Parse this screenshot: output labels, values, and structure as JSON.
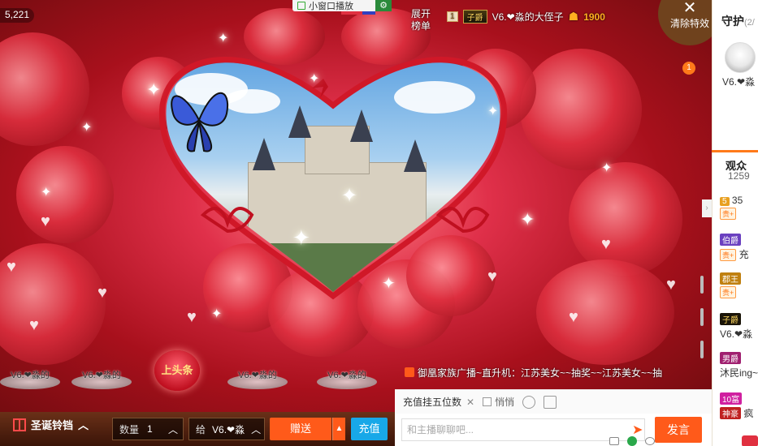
{
  "top_bar": {
    "viewer_count": "5,221",
    "mini_window_label": "小窗口播放",
    "expand_list_line1": "展开",
    "expand_list_line2": "榜单",
    "rank_number": "1",
    "rank_noble_badge": "子爵",
    "rank_user_name": "V6.❤淼的大侄子",
    "rank_coin_amount": "1900",
    "clear_effects_label": "清除特效"
  },
  "right_panel": {
    "guard_title": "守护",
    "guard_count": "(2/",
    "guard_user_name": "V6.❤淼",
    "audience_title": "观众",
    "audience_count": "1259",
    "audience_rows": [
      {
        "level": "5",
        "tag": "贵+",
        "extra": "35"
      },
      {
        "level": "伯爵",
        "tag": "贵+",
        "extra": "充"
      },
      {
        "level": "郡王",
        "tag": "贵+",
        "extra": ""
      },
      {
        "level": "子爵",
        "tag": "",
        "extra": "V6.❤淼"
      },
      {
        "level": "男爵",
        "tag": "",
        "extra": "沐民ing~"
      },
      {
        "level": "10富",
        "tag": "神豪",
        "extra": "疯"
      }
    ]
  },
  "chat": {
    "car_badge_count": "1",
    "announcement": "御凰家族广播~直升机：江苏美女~~抽奖~~江苏美女~~抽",
    "recharge_rank_tab": "充值挂五位数",
    "incognito_label": "悄悄",
    "input_placeholder": "和主播聊聊吧...",
    "send_label": "发言"
  },
  "gift_bar": {
    "christmas_bells_label": "圣诞铃铛",
    "quantity_label": "数量",
    "quantity_value": "1",
    "to_label": "给",
    "to_value": "V6.❤淼",
    "send_label": "赠送",
    "recharge_label": "充值"
  },
  "seats": {
    "seat_labels": [
      "V6.❤淼的",
      "V6.❤淼的",
      "V6.❤淼的",
      "V6.❤淼的",
      "V6.❤淼的"
    ],
    "headline_label": "上头条"
  },
  "colors": {
    "accent_orange": "#ff5a1a",
    "recharge_blue": "#18a8e8"
  }
}
